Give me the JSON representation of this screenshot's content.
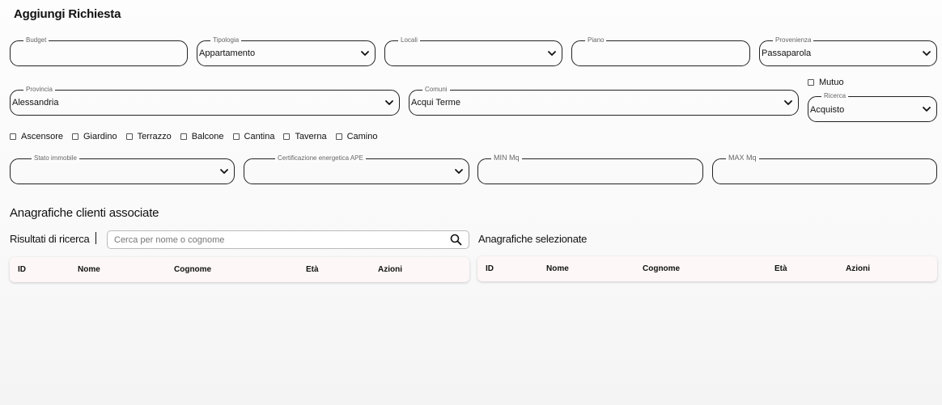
{
  "page": {
    "title": "Aggiungi Richiesta"
  },
  "form": {
    "budget": {
      "label": "Budget",
      "value": ""
    },
    "tipologia": {
      "label": "Tipologia",
      "value": "Appartamento"
    },
    "locali": {
      "label": "Locali",
      "value": ""
    },
    "piano": {
      "label": "Piano",
      "value": ""
    },
    "provenienza": {
      "label": "Provenienza",
      "value": "Passaparola"
    },
    "provincia": {
      "label": "Provincia",
      "value": "Alessandria"
    },
    "comuni": {
      "label": "Comuni",
      "value": "Acqui Terme"
    },
    "mutuo": {
      "label": "Mutuo",
      "checked": false
    },
    "ricerca": {
      "label": "Ricerca",
      "value": "Acquisto"
    },
    "features": [
      {
        "label": "Ascensore",
        "checked": false
      },
      {
        "label": "Giardino",
        "checked": false
      },
      {
        "label": "Terrazzo",
        "checked": false
      },
      {
        "label": "Balcone",
        "checked": false
      },
      {
        "label": "Cantina",
        "checked": false
      },
      {
        "label": "Taverna",
        "checked": false
      },
      {
        "label": "Camino",
        "checked": false
      }
    ],
    "stato_immobile": {
      "label": "Stato immobile",
      "value": ""
    },
    "ape": {
      "label": "Certificazione energetica APE",
      "value": ""
    },
    "min_mq": {
      "label": "MIN Mq",
      "value": ""
    },
    "max_mq": {
      "label": "MAX Mq",
      "value": ""
    }
  },
  "clients": {
    "title": "Anagrafiche clienti associate",
    "results_label": "Risultati di ricerca",
    "search_placeholder": "Cerca per nome o cognome",
    "selected_label": "Anagrafiche selezionate",
    "columns": [
      "ID",
      "Nome",
      "Cognome",
      "Età",
      "Azioni"
    ]
  },
  "icons": {
    "search": "search-icon",
    "chevron": "chevron-down-icon"
  }
}
